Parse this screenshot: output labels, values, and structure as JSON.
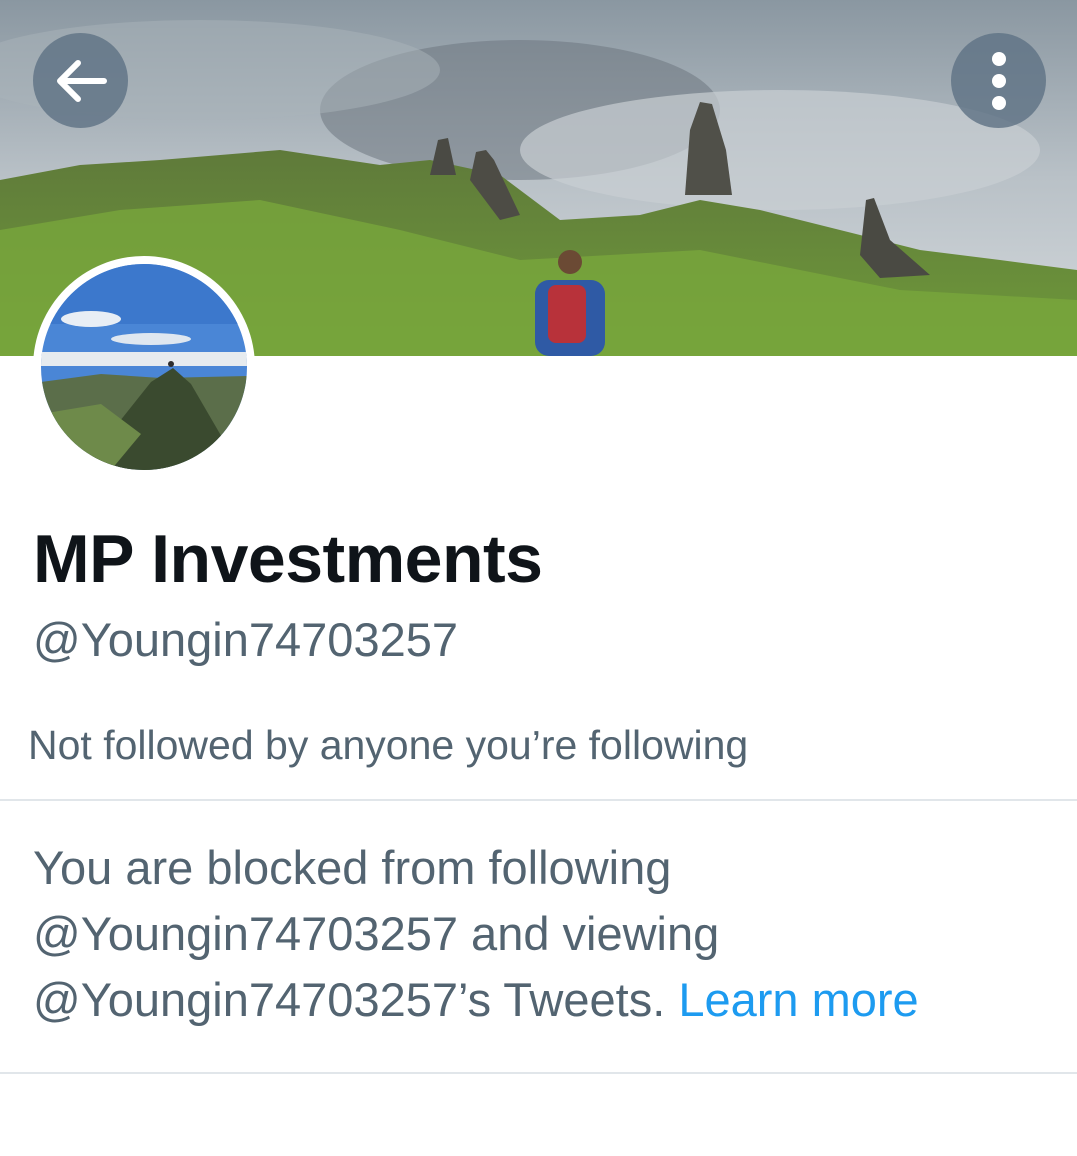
{
  "header": {
    "back_icon": "arrow-left-icon",
    "more_icon": "vertical-dots-icon"
  },
  "profile": {
    "display_name": "MP Investments",
    "handle": "@Youngin74703257",
    "followers_note": "Not followed by anyone you’re following"
  },
  "blocked_notice": {
    "line1": "You are blocked from following",
    "line2": "@Youngin74703257 and viewing",
    "line3_text": "@Youngin74703257’s Tweets.",
    "learn_more": "Learn more",
    "link_color": "#1d9bf0"
  },
  "colors": {
    "primary_text": "#0f1419",
    "secondary_text": "#536471",
    "divider": "#e1e6ea"
  }
}
